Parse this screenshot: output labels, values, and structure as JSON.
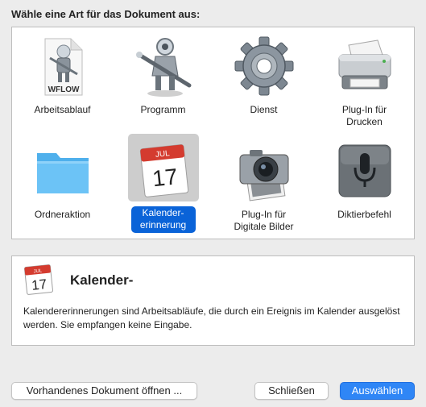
{
  "dialog": {
    "title": "Wähle eine Art für das Dokument aus:"
  },
  "tiles": [
    {
      "label": "Arbeitsablauf",
      "icon": "workflow-file-icon"
    },
    {
      "label": "Programm",
      "icon": "automator-robot-icon"
    },
    {
      "label": "Dienst",
      "icon": "gear-icon"
    },
    {
      "label": "Plug-In für\nDrucken",
      "icon": "printer-icon"
    },
    {
      "label": "Ordneraktion",
      "icon": "folder-icon"
    },
    {
      "label": "Kalender-\nerinnerung",
      "icon": "calendar-icon",
      "selected": true
    },
    {
      "label": "Plug-In für\nDigitale Bilder",
      "icon": "camera-icon"
    },
    {
      "label": "Diktierbefehl",
      "icon": "microphone-icon"
    }
  ],
  "workflow_icon_text": "WFLOW",
  "calendar": {
    "month": "JUL",
    "day": "17"
  },
  "description": {
    "title": "Kalender-",
    "text": "Kalendererinnerungen sind Arbeitsabläufe, die durch ein Ereignis im Kalender ausgelöst werden. Sie empfangen keine Eingabe."
  },
  "buttons": {
    "open_existing": "Vorhandenes Dokument öffnen ...",
    "close": "Schließen",
    "choose": "Auswählen"
  },
  "colors": {
    "accent": "#0a63d8",
    "primary_button": "#2f86f6",
    "calendar_red": "#d43b2f"
  }
}
